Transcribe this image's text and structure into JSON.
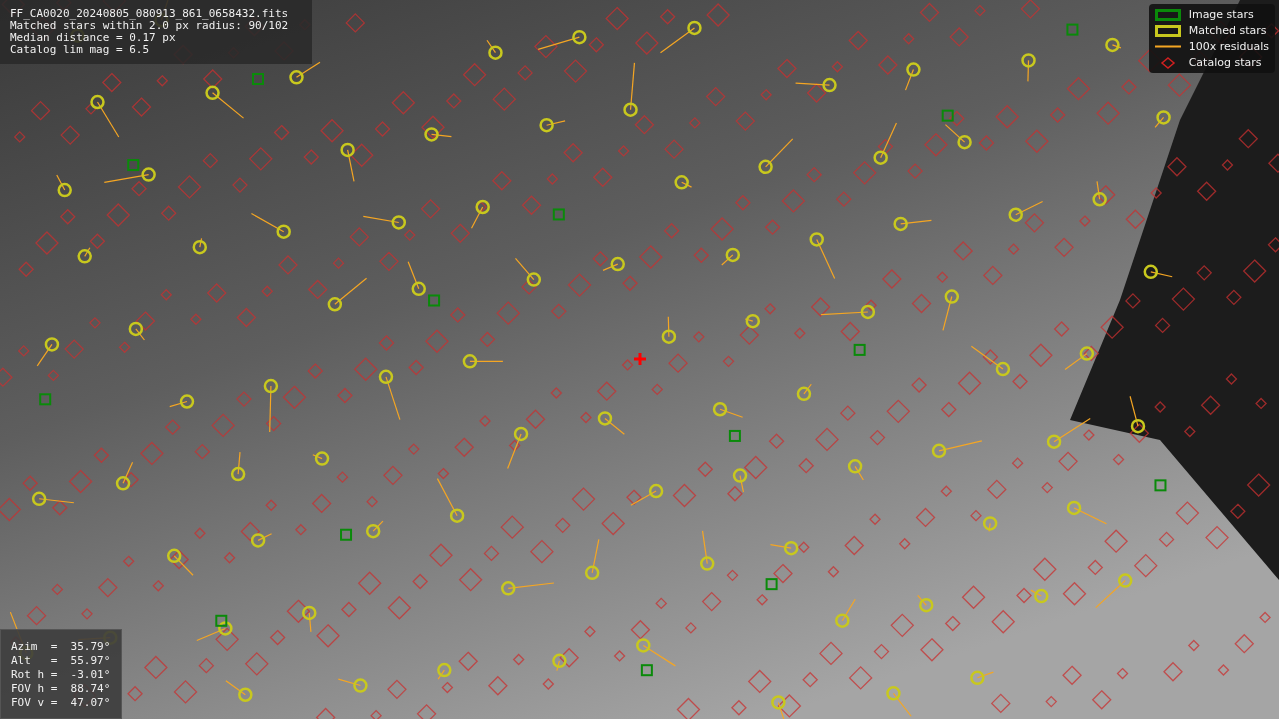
{
  "info": {
    "lines": [
      "FF_CA0020_20240805_080913_861_0658432.fits",
      "Matched stars within 2.0 px radius: 90/102",
      "Median distance = 0.17 px",
      "Catalog lim mag = 6.5"
    ]
  },
  "legend": [
    {
      "kind": "square",
      "color": "#0a8a0a",
      "label": "Image stars"
    },
    {
      "kind": "square",
      "color": "#c8c81e",
      "label": "Matched stars"
    },
    {
      "kind": "line",
      "color": "#f5a623",
      "label": "100x residuals"
    },
    {
      "kind": "diamond",
      "color": "#d02020",
      "label": "Catalog stars"
    }
  ],
  "pointing": {
    "lines": [
      "Azim  =  35.79°",
      "Alt   =  55.97°",
      "Rot h =  -3.01°",
      "FOV h =  88.74°",
      "FOV v =  47.07°"
    ]
  }
}
